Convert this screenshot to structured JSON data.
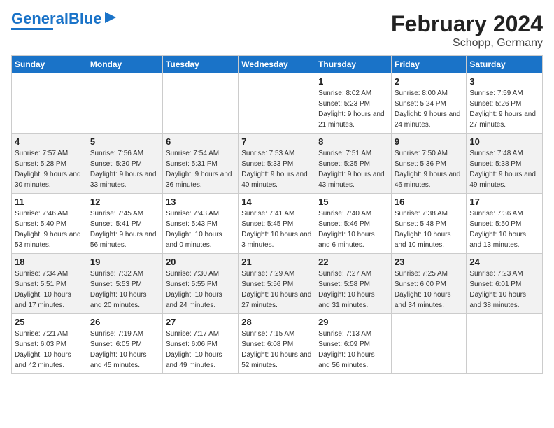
{
  "logo": {
    "part1": "General",
    "part2": "Blue"
  },
  "title": "February 2024",
  "subtitle": "Schopp, Germany",
  "days_header": [
    "Sunday",
    "Monday",
    "Tuesday",
    "Wednesday",
    "Thursday",
    "Friday",
    "Saturday"
  ],
  "weeks": [
    [
      {
        "num": "",
        "sunrise": "",
        "sunset": "",
        "daylight": ""
      },
      {
        "num": "",
        "sunrise": "",
        "sunset": "",
        "daylight": ""
      },
      {
        "num": "",
        "sunrise": "",
        "sunset": "",
        "daylight": ""
      },
      {
        "num": "",
        "sunrise": "",
        "sunset": "",
        "daylight": ""
      },
      {
        "num": "1",
        "sunrise": "Sunrise: 8:02 AM",
        "sunset": "Sunset: 5:23 PM",
        "daylight": "Daylight: 9 hours and 21 minutes."
      },
      {
        "num": "2",
        "sunrise": "Sunrise: 8:00 AM",
        "sunset": "Sunset: 5:24 PM",
        "daylight": "Daylight: 9 hours and 24 minutes."
      },
      {
        "num": "3",
        "sunrise": "Sunrise: 7:59 AM",
        "sunset": "Sunset: 5:26 PM",
        "daylight": "Daylight: 9 hours and 27 minutes."
      }
    ],
    [
      {
        "num": "4",
        "sunrise": "Sunrise: 7:57 AM",
        "sunset": "Sunset: 5:28 PM",
        "daylight": "Daylight: 9 hours and 30 minutes."
      },
      {
        "num": "5",
        "sunrise": "Sunrise: 7:56 AM",
        "sunset": "Sunset: 5:30 PM",
        "daylight": "Daylight: 9 hours and 33 minutes."
      },
      {
        "num": "6",
        "sunrise": "Sunrise: 7:54 AM",
        "sunset": "Sunset: 5:31 PM",
        "daylight": "Daylight: 9 hours and 36 minutes."
      },
      {
        "num": "7",
        "sunrise": "Sunrise: 7:53 AM",
        "sunset": "Sunset: 5:33 PM",
        "daylight": "Daylight: 9 hours and 40 minutes."
      },
      {
        "num": "8",
        "sunrise": "Sunrise: 7:51 AM",
        "sunset": "Sunset: 5:35 PM",
        "daylight": "Daylight: 9 hours and 43 minutes."
      },
      {
        "num": "9",
        "sunrise": "Sunrise: 7:50 AM",
        "sunset": "Sunset: 5:36 PM",
        "daylight": "Daylight: 9 hours and 46 minutes."
      },
      {
        "num": "10",
        "sunrise": "Sunrise: 7:48 AM",
        "sunset": "Sunset: 5:38 PM",
        "daylight": "Daylight: 9 hours and 49 minutes."
      }
    ],
    [
      {
        "num": "11",
        "sunrise": "Sunrise: 7:46 AM",
        "sunset": "Sunset: 5:40 PM",
        "daylight": "Daylight: 9 hours and 53 minutes."
      },
      {
        "num": "12",
        "sunrise": "Sunrise: 7:45 AM",
        "sunset": "Sunset: 5:41 PM",
        "daylight": "Daylight: 9 hours and 56 minutes."
      },
      {
        "num": "13",
        "sunrise": "Sunrise: 7:43 AM",
        "sunset": "Sunset: 5:43 PM",
        "daylight": "Daylight: 10 hours and 0 minutes."
      },
      {
        "num": "14",
        "sunrise": "Sunrise: 7:41 AM",
        "sunset": "Sunset: 5:45 PM",
        "daylight": "Daylight: 10 hours and 3 minutes."
      },
      {
        "num": "15",
        "sunrise": "Sunrise: 7:40 AM",
        "sunset": "Sunset: 5:46 PM",
        "daylight": "Daylight: 10 hours and 6 minutes."
      },
      {
        "num": "16",
        "sunrise": "Sunrise: 7:38 AM",
        "sunset": "Sunset: 5:48 PM",
        "daylight": "Daylight: 10 hours and 10 minutes."
      },
      {
        "num": "17",
        "sunrise": "Sunrise: 7:36 AM",
        "sunset": "Sunset: 5:50 PM",
        "daylight": "Daylight: 10 hours and 13 minutes."
      }
    ],
    [
      {
        "num": "18",
        "sunrise": "Sunrise: 7:34 AM",
        "sunset": "Sunset: 5:51 PM",
        "daylight": "Daylight: 10 hours and 17 minutes."
      },
      {
        "num": "19",
        "sunrise": "Sunrise: 7:32 AM",
        "sunset": "Sunset: 5:53 PM",
        "daylight": "Daylight: 10 hours and 20 minutes."
      },
      {
        "num": "20",
        "sunrise": "Sunrise: 7:30 AM",
        "sunset": "Sunset: 5:55 PM",
        "daylight": "Daylight: 10 hours and 24 minutes."
      },
      {
        "num": "21",
        "sunrise": "Sunrise: 7:29 AM",
        "sunset": "Sunset: 5:56 PM",
        "daylight": "Daylight: 10 hours and 27 minutes."
      },
      {
        "num": "22",
        "sunrise": "Sunrise: 7:27 AM",
        "sunset": "Sunset: 5:58 PM",
        "daylight": "Daylight: 10 hours and 31 minutes."
      },
      {
        "num": "23",
        "sunrise": "Sunrise: 7:25 AM",
        "sunset": "Sunset: 6:00 PM",
        "daylight": "Daylight: 10 hours and 34 minutes."
      },
      {
        "num": "24",
        "sunrise": "Sunrise: 7:23 AM",
        "sunset": "Sunset: 6:01 PM",
        "daylight": "Daylight: 10 hours and 38 minutes."
      }
    ],
    [
      {
        "num": "25",
        "sunrise": "Sunrise: 7:21 AM",
        "sunset": "Sunset: 6:03 PM",
        "daylight": "Daylight: 10 hours and 42 minutes."
      },
      {
        "num": "26",
        "sunrise": "Sunrise: 7:19 AM",
        "sunset": "Sunset: 6:05 PM",
        "daylight": "Daylight: 10 hours and 45 minutes."
      },
      {
        "num": "27",
        "sunrise": "Sunrise: 7:17 AM",
        "sunset": "Sunset: 6:06 PM",
        "daylight": "Daylight: 10 hours and 49 minutes."
      },
      {
        "num": "28",
        "sunrise": "Sunrise: 7:15 AM",
        "sunset": "Sunset: 6:08 PM",
        "daylight": "Daylight: 10 hours and 52 minutes."
      },
      {
        "num": "29",
        "sunrise": "Sunrise: 7:13 AM",
        "sunset": "Sunset: 6:09 PM",
        "daylight": "Daylight: 10 hours and 56 minutes."
      },
      {
        "num": "",
        "sunrise": "",
        "sunset": "",
        "daylight": ""
      },
      {
        "num": "",
        "sunrise": "",
        "sunset": "",
        "daylight": ""
      }
    ]
  ]
}
